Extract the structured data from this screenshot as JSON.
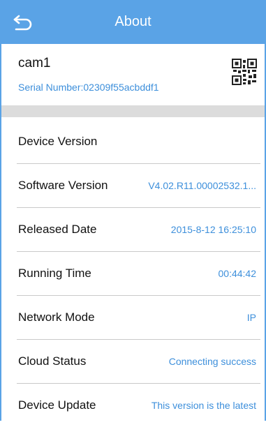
{
  "header": {
    "title": "About"
  },
  "device": {
    "name": "cam1",
    "serial": "Serial Number:02309f55acbddf1"
  },
  "info_rows": [
    {
      "label": "Device Version",
      "value": ""
    },
    {
      "label": "Software Version",
      "value": "V4.02.R11.00002532.1..."
    },
    {
      "label": "Released Date",
      "value": "2015-8-12 16:25:10"
    },
    {
      "label": "Running Time",
      "value": "00:44:42"
    },
    {
      "label": "Network Mode",
      "value": "IP"
    },
    {
      "label": "Cloud Status",
      "value": "Connecting success"
    },
    {
      "label": "Device Update",
      "value": "This version is the latest"
    }
  ],
  "colors": {
    "header": "#5aa3e6",
    "value_text": "#3d8fdb",
    "separator_band": "#dcdcdc"
  },
  "icons": {
    "back": "back-arrow-icon",
    "qr": "qr-code-icon"
  }
}
